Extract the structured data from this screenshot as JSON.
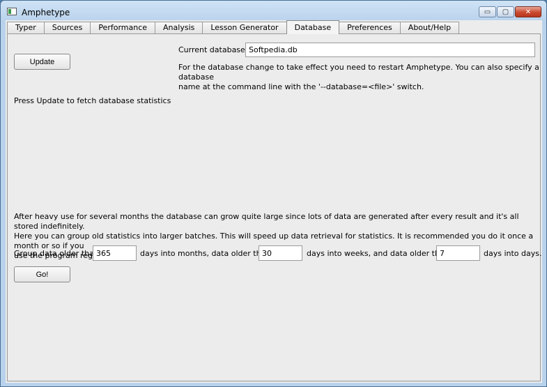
{
  "window": {
    "title": "Amphetype",
    "minimize": "▭",
    "maximize": "▢",
    "close": "✕"
  },
  "tabs": [
    "Typer",
    "Sources",
    "Performance",
    "Analysis",
    "Lesson Generator",
    "Database",
    "Preferences",
    "About/Help"
  ],
  "active_tab": "Database",
  "database": {
    "update_label": "Update",
    "current_db_label": "Current database:",
    "current_db_value": "Softpedia.db",
    "restart_note_line1": "For the database change to take effect you need to restart Amphetype. You can also specify a database",
    "restart_note_line2": "name at the command line with the '--database=<file>' switch.",
    "stats_status": "Press Update to fetch database statistics",
    "cleanup_line1": "After heavy use for several months the database can grow quite large since lots of data are generated after every result and it's all stored indefinitely.",
    "cleanup_line2": "Here you can group old statistics into larger batches. This will speed up data retrieval for statistics. It is recommended you do it once a month or so if you",
    "cleanup_line3": "use the program regularly.",
    "group_label_1": "Group data older than",
    "months_value": "365",
    "group_label_2": "days into months, data older than",
    "weeks_value": "30",
    "group_label_3": "days into weeks, and data older than",
    "days_value": "7",
    "group_label_4": "days into days.",
    "go_label": "Go!"
  }
}
